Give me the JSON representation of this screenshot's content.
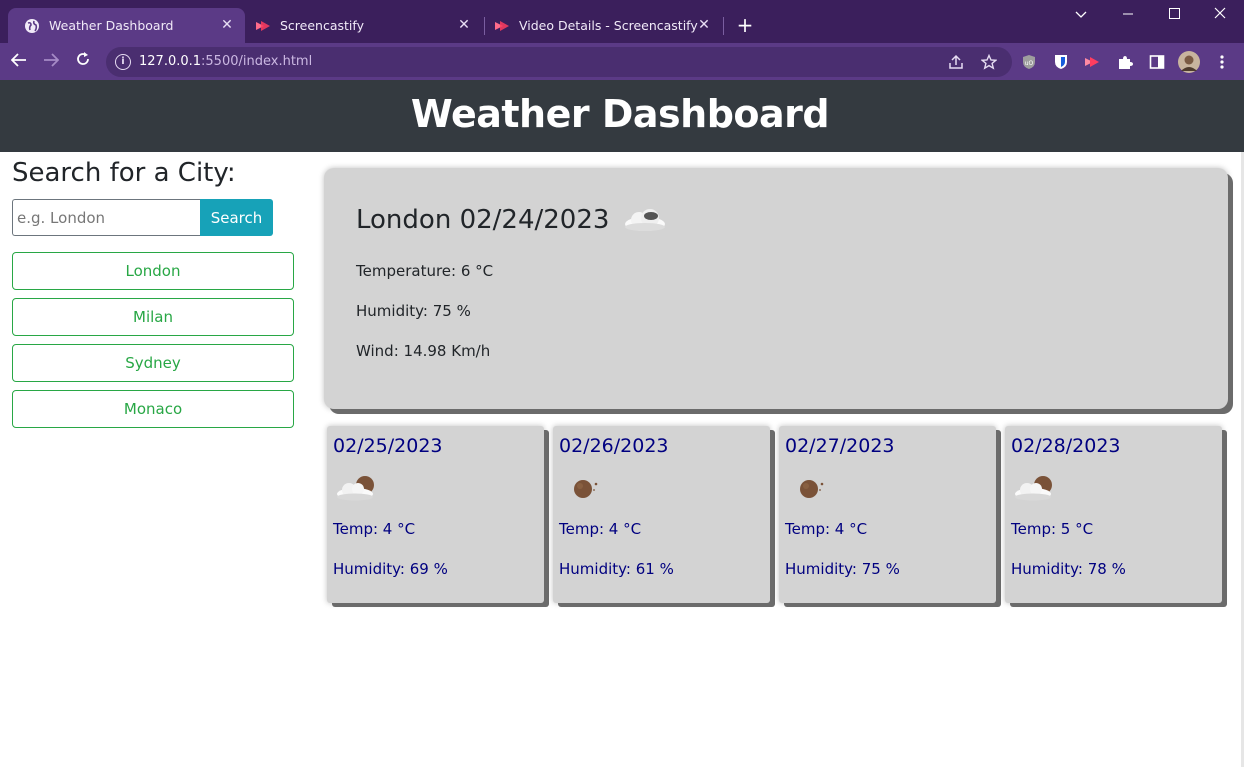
{
  "browser": {
    "tabs": [
      {
        "title": "Weather Dashboard",
        "icon": "globe-icon",
        "active": true
      },
      {
        "title": "Screencastify",
        "icon": "screencastify-icon",
        "active": false
      },
      {
        "title": "Video Details - Screencastify",
        "icon": "screencastify-icon",
        "active": false
      }
    ],
    "url_host": "127.0.0.1",
    "url_rest": ":5500/index.html",
    "theme_color": "#5b3a86"
  },
  "header": {
    "title": "Weather Dashboard"
  },
  "search": {
    "title": "Search for a City:",
    "placeholder": "e.g. London",
    "button_label": "Search",
    "history": [
      "London",
      "Milan",
      "Sydney",
      "Monaco"
    ]
  },
  "current": {
    "heading": "London 02/24/2023",
    "icon": "cloud-icon",
    "temperature": "Temperature: 6 °C",
    "humidity": "Humidity: 75 %",
    "wind": "Wind: 14.98 Km/h"
  },
  "forecast": [
    {
      "date": "02/25/2023",
      "icon": "cloudy-night-icon",
      "temp": "Temp: 4 °C",
      "humidity": "Humidity: 69 %"
    },
    {
      "date": "02/26/2023",
      "icon": "moon-icon",
      "temp": "Temp: 4 °C",
      "humidity": "Humidity: 61 %"
    },
    {
      "date": "02/27/2023",
      "icon": "moon-icon",
      "temp": "Temp: 4 °C",
      "humidity": "Humidity: 75 %"
    },
    {
      "date": "02/28/2023",
      "icon": "cloudy-night-icon",
      "temp": "Temp: 5 °C",
      "humidity": "Humidity: 78 %"
    }
  ]
}
